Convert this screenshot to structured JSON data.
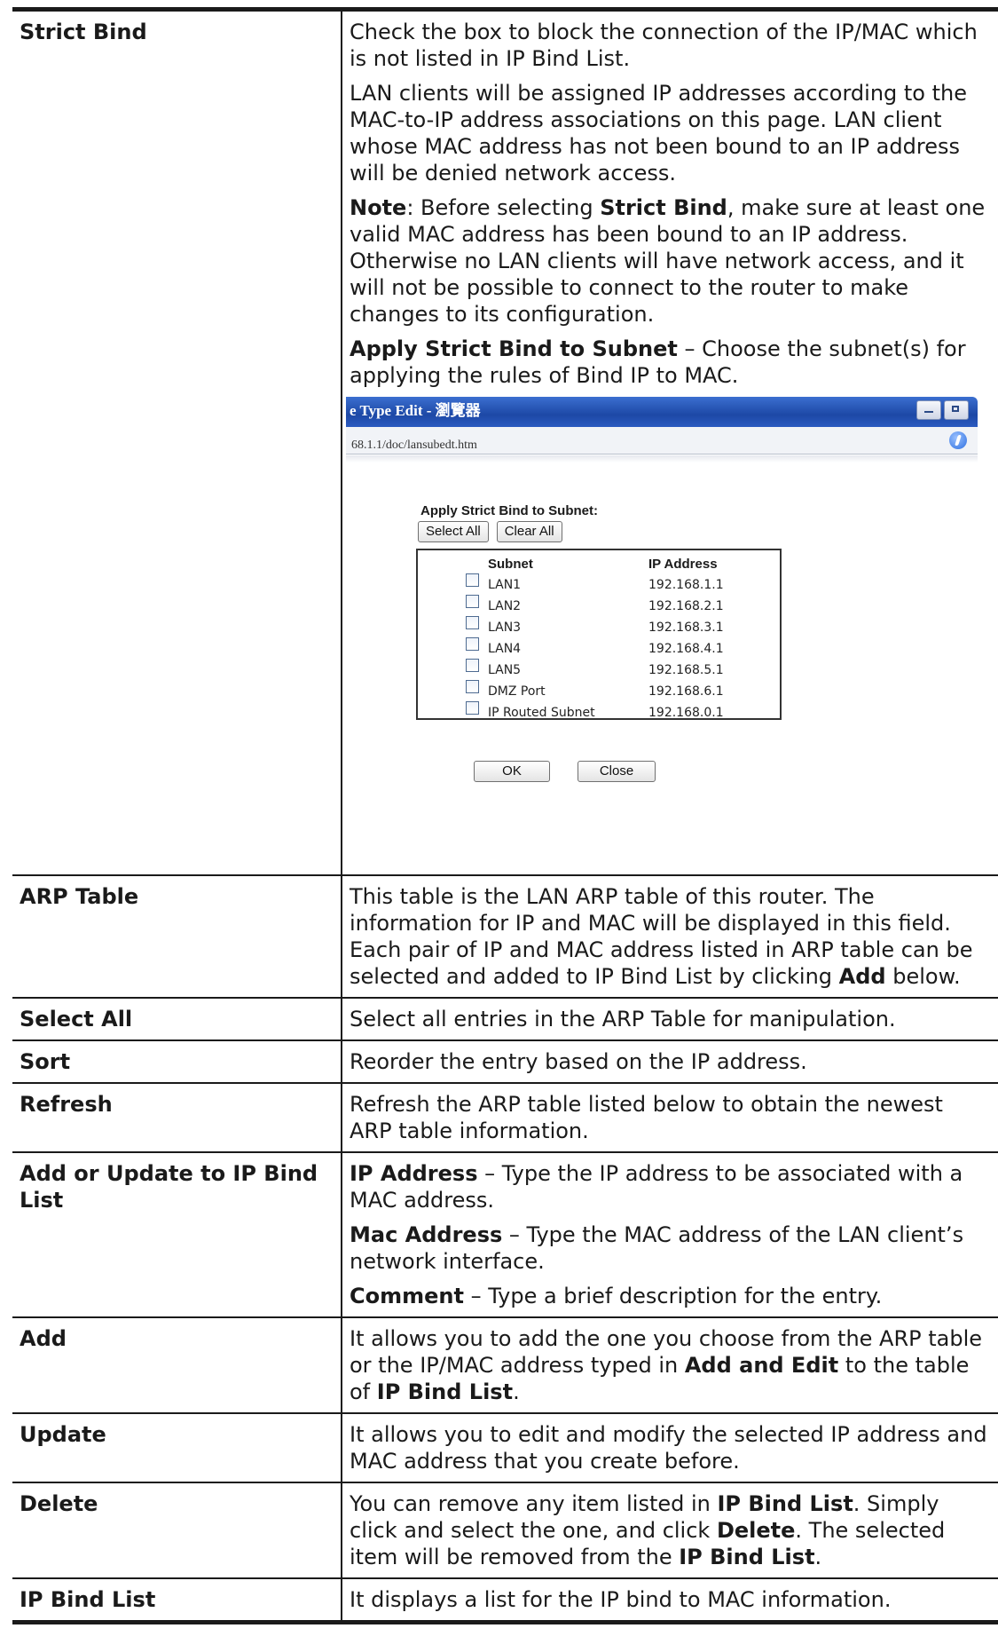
{
  "rows": [
    {
      "term": "Strict Bind",
      "paragraphs": [
        [
          {
            "t": "Check the box to block the connection of the IP/MAC which is not listed in IP Bind List.",
            "b": false
          }
        ],
        [
          {
            "t": "LAN clients will be assigned IP addresses according to the MAC-to-IP address associations on this page. LAN client whose MAC address has not been bound to an IP address will be denied network access.",
            "b": false
          }
        ],
        [
          {
            "t": "Note",
            "b": true
          },
          {
            "t": ": Before selecting ",
            "b": false
          },
          {
            "t": "Strict Bind",
            "b": true
          },
          {
            "t": ", make sure at least one valid MAC address has been bound to an IP address. Otherwise no LAN clients will have network access, and it will not be possible to connect to the router to make changes to its configuration.",
            "b": false
          }
        ],
        [
          {
            "t": "Apply Strict Bind to Subnet",
            "b": true
          },
          {
            "t": " – Choose the subnet(s) for applying the rules of Bind IP to MAC.",
            "b": false
          }
        ]
      ],
      "has_screenshot": true
    },
    {
      "term": "ARP Table",
      "paragraphs": [
        [
          {
            "t": "This table is the LAN ARP table of this router. The information for IP and MAC will be displayed in this field. Each pair of IP and MAC address listed in ARP table can be selected and added to IP Bind List by clicking ",
            "b": false
          },
          {
            "t": "Add",
            "b": true
          },
          {
            "t": " below.",
            "b": false
          }
        ]
      ]
    },
    {
      "term": "Select All",
      "paragraphs": [
        [
          {
            "t": "Select all entries in the ARP Table for manipulation.",
            "b": false
          }
        ]
      ]
    },
    {
      "term": "Sort",
      "paragraphs": [
        [
          {
            "t": "Reorder the entry based on the IP address.",
            "b": false
          }
        ]
      ]
    },
    {
      "term": "Refresh",
      "paragraphs": [
        [
          {
            "t": "Refresh the ARP table listed below to obtain the newest ARP table information.",
            "b": false
          }
        ]
      ]
    },
    {
      "term": "Add or Update to IP Bind List",
      "paragraphs": [
        [
          {
            "t": "IP Address",
            "b": true
          },
          {
            "t": " – Type the IP address to be associated with a MAC address.",
            "b": false
          }
        ],
        [
          {
            "t": "Mac Address",
            "b": true
          },
          {
            "t": " – Type the MAC address of the LAN client’s network interface.",
            "b": false
          }
        ],
        [
          {
            "t": "Comment",
            "b": true
          },
          {
            "t": " – Type a brief description for the entry.",
            "b": false
          }
        ]
      ]
    },
    {
      "term": "Add",
      "paragraphs": [
        [
          {
            "t": "It allows you to add the one you choose from the ARP table or the IP/MAC address typed in ",
            "b": false
          },
          {
            "t": "Add and Edit",
            "b": true
          },
          {
            "t": " to the table of ",
            "b": false
          },
          {
            "t": "IP Bind List",
            "b": true
          },
          {
            "t": ".",
            "b": false
          }
        ]
      ]
    },
    {
      "term": "Update",
      "paragraphs": [
        [
          {
            "t": "It allows you to edit and modify the selected IP address and MAC address that you create before.",
            "b": false
          }
        ]
      ]
    },
    {
      "term": "Delete",
      "paragraphs": [
        [
          {
            "t": "You can remove any item listed in ",
            "b": false
          },
          {
            "t": "IP Bind List",
            "b": true
          },
          {
            "t": ". Simply click and select the one, and click ",
            "b": false
          },
          {
            "t": "Delete",
            "b": true
          },
          {
            "t": ". The selected item will be removed from the ",
            "b": false
          },
          {
            "t": "IP Bind List",
            "b": true
          },
          {
            "t": ".",
            "b": false
          }
        ]
      ]
    },
    {
      "term": "IP Bind List",
      "paragraphs": [
        [
          {
            "t": "It displays a list for the IP bind to MAC information.",
            "b": false
          }
        ]
      ]
    }
  ],
  "screenshot": {
    "window_title": "e Type Edit - 瀏覽器",
    "url": "68.1.1/doc/lansubedt.htm",
    "heading": "Apply Strict Bind to Subnet:",
    "select_all_label": "Select All",
    "clear_all_label": "Clear All",
    "col_subnet": "Subnet",
    "col_ip": "IP Address",
    "subnets": [
      {
        "name": "LAN1",
        "ip": "192.168.1.1"
      },
      {
        "name": "LAN2",
        "ip": "192.168.2.1"
      },
      {
        "name": "LAN3",
        "ip": "192.168.3.1"
      },
      {
        "name": "LAN4",
        "ip": "192.168.4.1"
      },
      {
        "name": "LAN5",
        "ip": "192.168.5.1"
      },
      {
        "name": "DMZ Port",
        "ip": "192.168.6.1"
      },
      {
        "name": "IP Routed Subnet",
        "ip": "192.168.0.1"
      }
    ],
    "ok_label": "OK",
    "close_label": "Close"
  }
}
